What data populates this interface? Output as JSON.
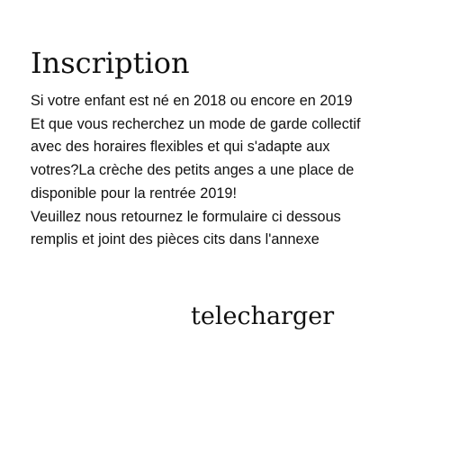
{
  "title": "Inscription",
  "body_lines": [
    "Si votre enfant est né en 2018 ou encore en 2019",
    "Et que vous recherchez un mode de garde collectif",
    "avec des horaires flexibles et qui s'adapte aux",
    "votres?La crèche des petits anges a une place de",
    "disponible pour la rentrée 2019!",
    "Veuillez nous retournez le formulaire ci dessous",
    "remplis et joint des pièces cits dans l'annexe"
  ],
  "download_label": "telecharger",
  "colors": {
    "background": "#ffffff",
    "text": "#111111"
  }
}
